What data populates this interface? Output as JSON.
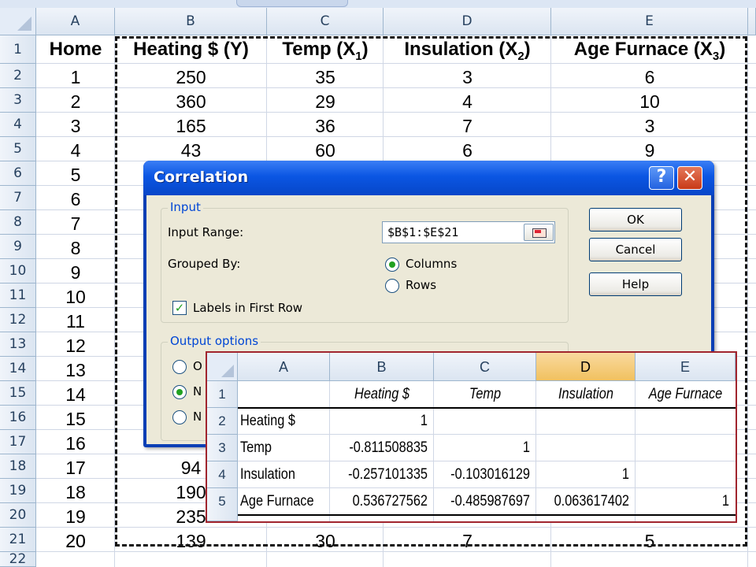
{
  "columns": [
    "A",
    "B",
    "C",
    "D",
    "E"
  ],
  "rows": [
    "1",
    "2",
    "3",
    "4",
    "5",
    "6",
    "7",
    "8",
    "9",
    "10",
    "11",
    "12",
    "13",
    "14",
    "15",
    "16",
    "17",
    "18",
    "19",
    "20",
    "21",
    "22"
  ],
  "headers": {
    "home": "Home",
    "heating_pre": "Heating $ (Y)",
    "temp_pre": "Temp (X",
    "temp_sub": "1",
    "ins_pre": "Insulation (X",
    "ins_sub": "2",
    "age_pre": "Age Furnace (X",
    "age_sub": "3",
    "close_paren": ")"
  },
  "data_rows": [
    [
      "1",
      "250",
      "35",
      "3",
      "6"
    ],
    [
      "2",
      "360",
      "29",
      "4",
      "10"
    ],
    [
      "3",
      "165",
      "36",
      "7",
      "3"
    ],
    [
      "4",
      "43",
      "60",
      "6",
      "9"
    ]
  ],
  "home_tail": [
    "5",
    "6",
    "7",
    "8",
    "9",
    "10",
    "11",
    "12",
    "13",
    "14",
    "15",
    "16",
    "17",
    "18",
    "19",
    "20"
  ],
  "partial_b": {
    "r18": "94",
    "r19": "190",
    "r20": "235"
  },
  "last_row": [
    "20",
    "139",
    "30",
    "7",
    "5"
  ],
  "dialog": {
    "title": "Correlation",
    "help_glyph": "?",
    "close_glyph": "✕",
    "input_group": "Input",
    "input_range_label": "Input Range:",
    "input_range_value": "$B$1:$E$21",
    "grouped_by_label": "Grouped By:",
    "columns_option": "Columns",
    "rows_option": "Rows",
    "labels_checkbox": "Labels in First Row",
    "output_group": "Output options",
    "ok": "OK",
    "cancel": "Cancel",
    "help": "Help",
    "radio_frag_1": "O",
    "radio_frag_2": "N",
    "radio_frag_3": "N"
  },
  "results": {
    "columns": [
      "A",
      "B",
      "C",
      "D",
      "E"
    ],
    "row_numbers": [
      "1",
      "2",
      "3",
      "4",
      "5"
    ],
    "col_headers": [
      "Heating $",
      "Temp",
      "Insulation",
      "Age Furnace"
    ],
    "row_labels": [
      "Heating $",
      "Temp",
      "Insulation",
      "Age Furnace"
    ],
    "matrix": [
      [
        "1",
        "",
        "",
        ""
      ],
      [
        "-0.811508835",
        "1",
        "",
        ""
      ],
      [
        "-0.257101335",
        "-0.103016129",
        "1",
        ""
      ],
      [
        "0.536727562",
        "-0.485987697",
        "0.063617402",
        "1"
      ]
    ]
  }
}
